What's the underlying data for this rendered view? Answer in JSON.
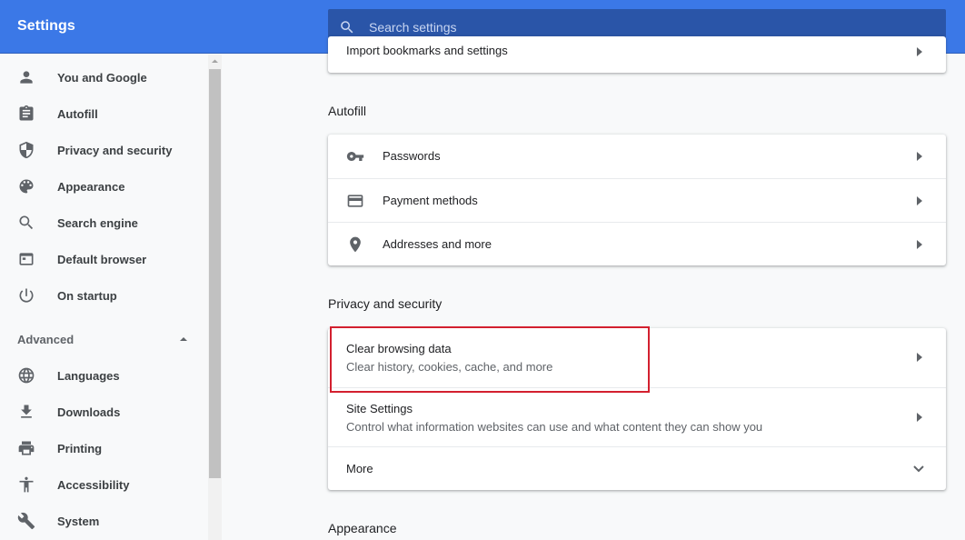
{
  "header": {
    "title": "Settings",
    "search_placeholder": "Search settings"
  },
  "sidebar": {
    "items": [
      {
        "label": "You and Google",
        "icon": "person-icon"
      },
      {
        "label": "Autofill",
        "icon": "clipboard-icon"
      },
      {
        "label": "Privacy and security",
        "icon": "shield-icon"
      },
      {
        "label": "Appearance",
        "icon": "palette-icon"
      },
      {
        "label": "Search engine",
        "icon": "search-icon"
      },
      {
        "label": "Default browser",
        "icon": "browser-icon"
      },
      {
        "label": "On startup",
        "icon": "power-icon"
      }
    ],
    "advanced_label": "Advanced",
    "advanced_items": [
      {
        "label": "Languages",
        "icon": "globe-icon"
      },
      {
        "label": "Downloads",
        "icon": "download-icon"
      },
      {
        "label": "Printing",
        "icon": "printer-icon"
      },
      {
        "label": "Accessibility",
        "icon": "accessibility-icon"
      },
      {
        "label": "System",
        "icon": "wrench-icon"
      }
    ]
  },
  "main": {
    "top_card_label": "Import bookmarks and settings",
    "autofill": {
      "title": "Autofill",
      "rows": [
        {
          "label": "Passwords",
          "icon": "key-icon"
        },
        {
          "label": "Payment methods",
          "icon": "credit-card-icon"
        },
        {
          "label": "Addresses and more",
          "icon": "location-pin-icon"
        }
      ]
    },
    "privacy": {
      "title": "Privacy and security",
      "rows": [
        {
          "title": "Clear browsing data",
          "subtitle": "Clear history, cookies, cache, and more"
        },
        {
          "title": "Site Settings",
          "subtitle": "Control what information websites can use and what content they can show you"
        },
        {
          "title": "More"
        }
      ]
    },
    "appearance_title": "Appearance"
  },
  "colors": {
    "header_blue": "#3b78e7",
    "search_blue": "#2a55a8",
    "highlight_red": "#d3202f"
  }
}
